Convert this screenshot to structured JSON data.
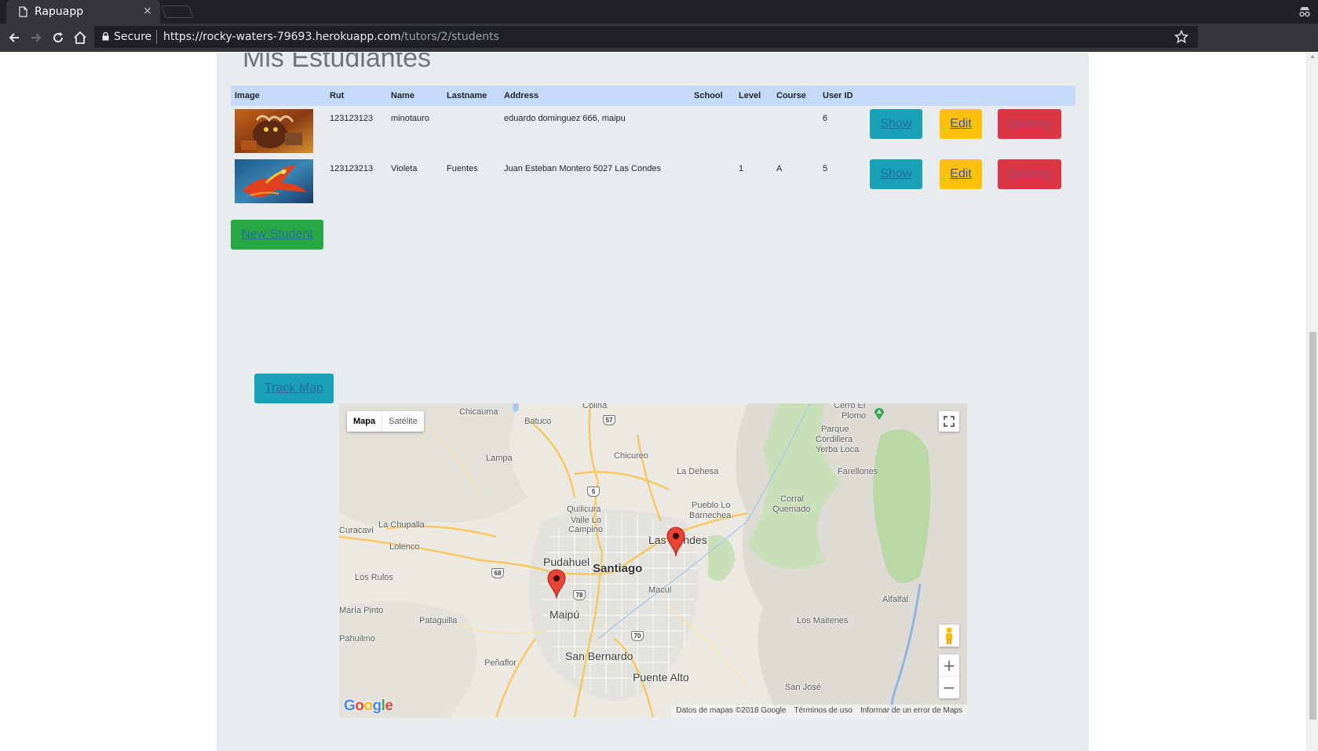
{
  "browser": {
    "tab_title": "Rapuapp",
    "tab_close": "×",
    "secure_label": "Secure",
    "url_host": "https://rocky-waters-79693.herokuapp.com",
    "url_path": "/tutors/2/students"
  },
  "students_section": {
    "heading": "Mis Estudiantes",
    "columns": [
      "Image",
      "Rut",
      "Name",
      "Lastname",
      "Address",
      "School",
      "Level",
      "Course",
      "User ID"
    ],
    "rows": [
      {
        "image": "minotaur-avatar",
        "rut": "123123123",
        "name": "minotauro",
        "lastname": "",
        "address": "eduardo dominguez 666, maipu",
        "school": "",
        "level": "",
        "course": "",
        "user_id": "6"
      },
      {
        "image": "phoenix-avatar",
        "rut": "123123213",
        "name": "Violeta",
        "lastname": "Fuentes",
        "address": "Juan Esteban Montero 5027 Las Condes",
        "school": "",
        "level": "1",
        "course": "A",
        "user_id": "5"
      }
    ],
    "show_label": "Show",
    "edit_label": "Edit",
    "destroy_label": "Destroy",
    "new_student_label": "New Student",
    "colors": {
      "show": "#17a2b8",
      "edit": "#ffc107",
      "destroy": "#dc3545",
      "new": "#28a745",
      "header": "#c5daf8"
    }
  },
  "map_section": {
    "track_map_label": "Track Map",
    "map_type_map": "Mapa",
    "map_type_satellite": "Satélite",
    "zoom_in": "+",
    "zoom_out": "−",
    "logo": "Google",
    "attribution": {
      "data": "Datos de mapas ©2018 Google",
      "terms": "Términos de uso",
      "report": "Informar de un error de Maps"
    },
    "places": {
      "colina": "Colina",
      "chicauma": "Chicauma",
      "batuco": "Batuco",
      "cerro_el_plomo": "Cerro El",
      "cerro_el_plomo_2": "Plomo",
      "parque_cordillera": "Parque",
      "parque_cordillera_2": "Cordillera",
      "parque_cordillera_3": "Yerba Loca",
      "lampa": "Lampa",
      "chicureo": "Chicureo",
      "la_dehesa": "La Dehesa",
      "farellones": "Farellones",
      "corral_quemado": "Corral",
      "corral_quemado_2": "Quemado",
      "pueblo_lo_barnechea": "Pueblo Lo",
      "pueblo_lo_barnechea_2": "Barnechea",
      "quilicura": "Quilicura",
      "valle_lo_campino": "Valle Lo",
      "valle_lo_campino_2": "Campino",
      "curacavi": "Curacaví",
      "la_chupalla": "La Chupalla",
      "lolenco": "Lolenco",
      "las_condes": "Las Condes",
      "pudahuel": "Pudahuel",
      "santiago": "Santiago",
      "los_rulos": "Los Rulos",
      "macul": "Macul",
      "alfalfal": "Alfalfal",
      "maria_pinto": "María Pinto",
      "maipu": "Maipú",
      "pataguilla": "Pataguilla",
      "los_maitenes": "Los Maitenes",
      "puhuilmo": "Pahuilmo",
      "san_bernardo": "San Bernardo",
      "penaflor": "Peñaflor",
      "puente_alto": "Puente Alto",
      "san_jose": "San José"
    },
    "routes": {
      "r57": "57",
      "r5": "5",
      "r68": "68",
      "r78": "78",
      "r70": "70"
    },
    "marker_color": "#ea4335"
  }
}
